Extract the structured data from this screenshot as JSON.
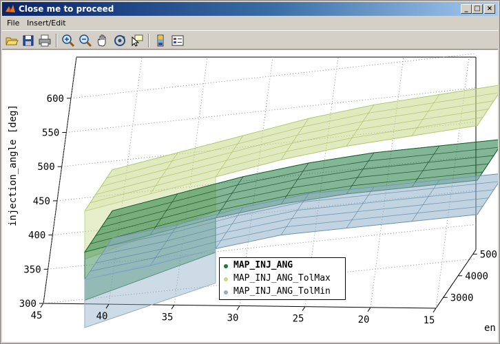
{
  "window": {
    "title": "Close me to proceed",
    "buttons": {
      "minimize": "_",
      "maximize": "□",
      "close": "×"
    }
  },
  "menu": {
    "file": "File",
    "insert_edit": "Insert/Edit"
  },
  "toolbar": {
    "icons": [
      "open-icon",
      "save-icon",
      "print-icon",
      "zoom-in-icon",
      "zoom-out-icon",
      "pan-hand-icon",
      "rotate-3d-icon",
      "data-cursor-icon",
      "colorbar-icon",
      "legend-icon"
    ]
  },
  "colors": {
    "map": "#1e7a3c",
    "tolmax": "#c8d88a",
    "tolmin": "#8fb0c8",
    "accent": "#0a246a"
  },
  "chart_data": {
    "type": "surface3d",
    "zlabel": "injection_angle [deg]",
    "ylabel": "en",
    "x_ticks": [
      "45",
      "40",
      "35",
      "30",
      "25",
      "20",
      "15"
    ],
    "y_ticks": [
      "3000",
      "4000",
      "5000"
    ],
    "z_ticks": [
      "300",
      "350",
      "400",
      "450",
      "500",
      "550",
      "600"
    ],
    "xlim": [
      15,
      45
    ],
    "ylim": [
      2500,
      5200
    ],
    "zlim": [
      300,
      630
    ],
    "grid": true,
    "legend_position": "lower-right",
    "series": [
      {
        "name": "MAP_INJ_ANG",
        "color": "#1e7a3c",
        "bold": true,
        "front_edge": [
          [
            45,
            370
          ],
          [
            40,
            395
          ],
          [
            35,
            420
          ],
          [
            30,
            440
          ],
          [
            25,
            455
          ],
          [
            20,
            465
          ],
          [
            15,
            475
          ]
        ]
      },
      {
        "name": "MAP_INJ_ANG_TolMax",
        "color": "#c8d88a",
        "front_edge": [
          [
            45,
            430
          ],
          [
            40,
            455
          ],
          [
            35,
            480
          ],
          [
            30,
            505
          ],
          [
            25,
            525
          ],
          [
            20,
            540
          ],
          [
            15,
            555
          ]
        ]
      },
      {
        "name": "MAP_INJ_ANG_TolMin",
        "color": "#8fb0c8",
        "front_edge": [
          [
            45,
            330
          ],
          [
            40,
            350
          ],
          [
            35,
            375
          ],
          [
            30,
            395
          ],
          [
            25,
            405
          ],
          [
            20,
            415
          ],
          [
            15,
            425
          ]
        ]
      }
    ]
  }
}
